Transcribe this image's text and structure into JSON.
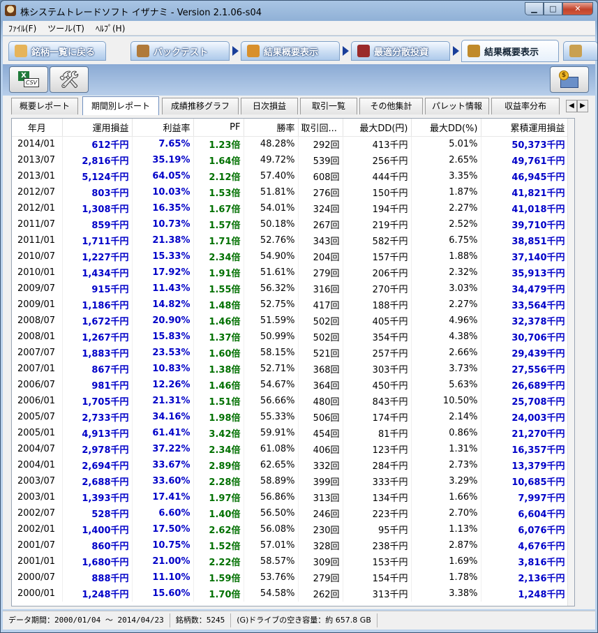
{
  "window": {
    "title": "株システムトレードソフト イザナミ - Version 2.1.06-s04",
    "controls": {
      "minimize": "▁",
      "maximize": "□",
      "close": "✕"
    }
  },
  "menu": [
    "ﾌｧｲﾙ(F)",
    "ツール(T)",
    "ﾍﾙﾌﾟ(H)"
  ],
  "nav_tabs": [
    {
      "label": "銘柄一覧に戻る",
      "icon": "eye-icon",
      "color": "#e6b45a"
    },
    {
      "label": "バックテスト",
      "icon": "bag-icon",
      "color": "#b07a3a"
    },
    {
      "label": "結果概要表示",
      "icon": "money-bag-icon",
      "color": "#d8902c"
    },
    {
      "label": "最適分散投資",
      "icon": "calculator-icon",
      "color": "#9a2a2a"
    },
    {
      "label": "結果概要表示",
      "icon": "bar-chart-icon",
      "color": "#c08a2a"
    },
    {
      "label": "",
      "icon": "report-icon",
      "color": "#c9a050"
    }
  ],
  "toolbar": {
    "csv_excel": "X",
    "csv_label": "CSV",
    "money_coin": "$"
  },
  "sub_tabs": {
    "items": [
      "概要レポート",
      "期間別レポート",
      "成績推移グラフ",
      "日次損益",
      "取引一覧",
      "その他集計",
      "パレット情報",
      "収益率分布"
    ],
    "active": 1,
    "scroll_left": "◀",
    "scroll_right": "▶"
  },
  "table": {
    "columns": [
      "年月",
      "運用損益",
      "利益率",
      "PF",
      "勝率",
      "取引回...",
      "最大DD(円)",
      "最大DD(%)",
      "累積運用損益"
    ],
    "rows": [
      [
        "2014/01",
        "612千円",
        "7.65%",
        "1.23倍",
        "48.28%",
        "292回",
        "413千円",
        "5.01%",
        "50,373千円"
      ],
      [
        "2013/07",
        "2,816千円",
        "35.19%",
        "1.64倍",
        "49.72%",
        "539回",
        "256千円",
        "2.65%",
        "49,761千円"
      ],
      [
        "2013/01",
        "5,124千円",
        "64.05%",
        "2.12倍",
        "57.40%",
        "608回",
        "444千円",
        "3.35%",
        "46,945千円"
      ],
      [
        "2012/07",
        "803千円",
        "10.03%",
        "1.53倍",
        "51.81%",
        "276回",
        "150千円",
        "1.87%",
        "41,821千円"
      ],
      [
        "2012/01",
        "1,308千円",
        "16.35%",
        "1.67倍",
        "54.01%",
        "324回",
        "194千円",
        "2.27%",
        "41,018千円"
      ],
      [
        "2011/07",
        "859千円",
        "10.73%",
        "1.57倍",
        "50.18%",
        "267回",
        "219千円",
        "2.52%",
        "39,710千円"
      ],
      [
        "2011/01",
        "1,711千円",
        "21.38%",
        "1.71倍",
        "52.76%",
        "343回",
        "582千円",
        "6.75%",
        "38,851千円"
      ],
      [
        "2010/07",
        "1,227千円",
        "15.33%",
        "2.34倍",
        "54.90%",
        "204回",
        "157千円",
        "1.88%",
        "37,140千円"
      ],
      [
        "2010/01",
        "1,434千円",
        "17.92%",
        "1.91倍",
        "51.61%",
        "279回",
        "206千円",
        "2.32%",
        "35,913千円"
      ],
      [
        "2009/07",
        "915千円",
        "11.43%",
        "1.55倍",
        "56.32%",
        "316回",
        "270千円",
        "3.03%",
        "34,479千円"
      ],
      [
        "2009/01",
        "1,186千円",
        "14.82%",
        "1.48倍",
        "52.75%",
        "417回",
        "188千円",
        "2.27%",
        "33,564千円"
      ],
      [
        "2008/07",
        "1,672千円",
        "20.90%",
        "1.46倍",
        "51.59%",
        "502回",
        "405千円",
        "4.96%",
        "32,378千円"
      ],
      [
        "2008/01",
        "1,267千円",
        "15.83%",
        "1.37倍",
        "50.99%",
        "502回",
        "354千円",
        "4.38%",
        "30,706千円"
      ],
      [
        "2007/07",
        "1,883千円",
        "23.53%",
        "1.60倍",
        "58.15%",
        "521回",
        "257千円",
        "2.66%",
        "29,439千円"
      ],
      [
        "2007/01",
        "867千円",
        "10.83%",
        "1.38倍",
        "52.71%",
        "368回",
        "303千円",
        "3.73%",
        "27,556千円"
      ],
      [
        "2006/07",
        "981千円",
        "12.26%",
        "1.46倍",
        "54.67%",
        "364回",
        "450千円",
        "5.63%",
        "26,689千円"
      ],
      [
        "2006/01",
        "1,705千円",
        "21.31%",
        "1.51倍",
        "56.66%",
        "480回",
        "843千円",
        "10.50%",
        "25,708千円"
      ],
      [
        "2005/07",
        "2,733千円",
        "34.16%",
        "1.98倍",
        "55.33%",
        "506回",
        "174千円",
        "2.14%",
        "24,003千円"
      ],
      [
        "2005/01",
        "4,913千円",
        "61.41%",
        "3.42倍",
        "59.91%",
        "454回",
        "81千円",
        "0.86%",
        "21,270千円"
      ],
      [
        "2004/07",
        "2,978千円",
        "37.22%",
        "2.34倍",
        "61.08%",
        "406回",
        "123千円",
        "1.31%",
        "16,357千円"
      ],
      [
        "2004/01",
        "2,694千円",
        "33.67%",
        "2.89倍",
        "62.65%",
        "332回",
        "284千円",
        "2.73%",
        "13,379千円"
      ],
      [
        "2003/07",
        "2,688千円",
        "33.60%",
        "2.28倍",
        "58.89%",
        "399回",
        "333千円",
        "3.29%",
        "10,685千円"
      ],
      [
        "2003/01",
        "1,393千円",
        "17.41%",
        "1.97倍",
        "56.86%",
        "313回",
        "134千円",
        "1.66%",
        "7,997千円"
      ],
      [
        "2002/07",
        "528千円",
        "6.60%",
        "1.40倍",
        "56.50%",
        "246回",
        "223千円",
        "2.70%",
        "6,604千円"
      ],
      [
        "2002/01",
        "1,400千円",
        "17.50%",
        "2.62倍",
        "56.08%",
        "230回",
        "95千円",
        "1.13%",
        "6,076千円"
      ],
      [
        "2001/07",
        "860千円",
        "10.75%",
        "1.52倍",
        "57.01%",
        "328回",
        "238千円",
        "2.87%",
        "4,676千円"
      ],
      [
        "2001/01",
        "1,680千円",
        "21.00%",
        "2.22倍",
        "58.57%",
        "309回",
        "153千円",
        "1.69%",
        "3,816千円"
      ],
      [
        "2000/07",
        "888千円",
        "11.10%",
        "1.59倍",
        "53.76%",
        "279回",
        "154千円",
        "1.78%",
        "2,136千円"
      ],
      [
        "2000/01",
        "1,248千円",
        "15.60%",
        "1.70倍",
        "54.58%",
        "262回",
        "313千円",
        "3.38%",
        "1,248千円"
      ]
    ]
  },
  "status": {
    "period": "データ期間：2000/01/04 〜 2014/04/23",
    "stocks": "銘柄数：5245",
    "drive": "(G)ドライブの空き容量：約 657.8 GB"
  },
  "colors": {
    "profit_blue": "#0000c8",
    "pf_green": "#007000",
    "title_gradient": "#8fb0d6"
  }
}
